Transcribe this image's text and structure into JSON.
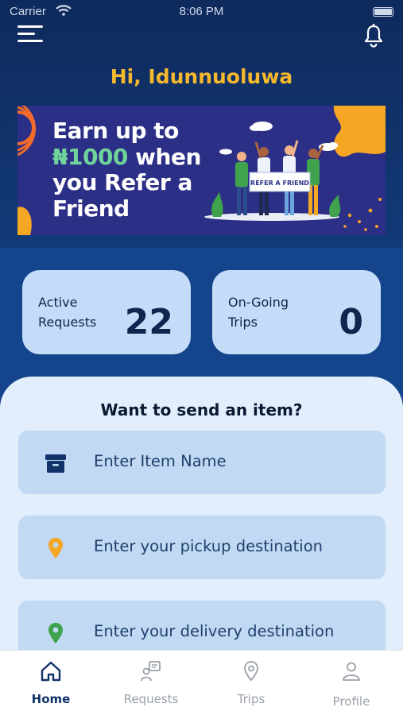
{
  "status_bar": {
    "carrier": "Carrier",
    "time": "8:06 PM"
  },
  "header": {
    "greeting": "Hi, Idunnuoluwa",
    "menu_icon": "hamburger-menu-icon",
    "notification_icon": "bell-icon"
  },
  "banner": {
    "line1": "Earn  up to",
    "amount": "₦1000",
    "line2_rest": " when",
    "line3": "you Refer a",
    "line4": "Friend",
    "sign_text": "REFER A FRIEND"
  },
  "stats": [
    {
      "label_line1": "Active",
      "label_line2": "Requests",
      "value": "22"
    },
    {
      "label_line1": "On-Going",
      "label_line2": "Trips",
      "value": "0"
    }
  ],
  "send_form": {
    "title": "Want to send an item?",
    "item_placeholder": "Enter Item Name",
    "pickup_placeholder": "Enter your pickup destination",
    "delivery_placeholder": "Enter your delivery destination"
  },
  "colors": {
    "greeting": "#f5b82e",
    "pickup_pin": "#f5a623",
    "delivery_pin": "#3fa34d",
    "navy": "#12326a"
  },
  "bottom_nav": [
    {
      "label": "Home",
      "icon": "home-icon",
      "active": true
    },
    {
      "label": "Requests",
      "icon": "requests-icon",
      "active": false
    },
    {
      "label": "Trips",
      "icon": "location-pin-icon",
      "active": false
    },
    {
      "label": "Profile",
      "icon": "user-icon",
      "active": false
    }
  ]
}
